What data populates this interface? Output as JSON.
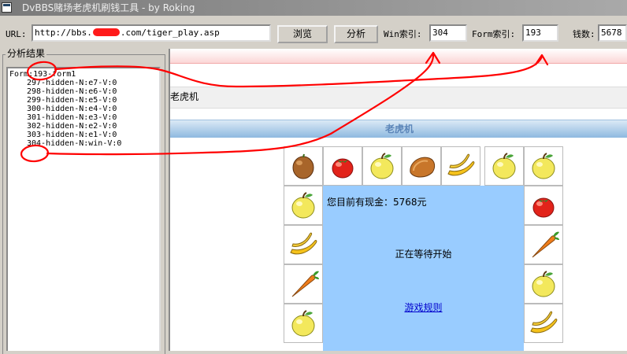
{
  "window": {
    "title": "DvBBS赌场老虎机刷钱工具 - by Roking"
  },
  "toolbar": {
    "url_label": "URL:",
    "url_prefix": "http://bbs.",
    "url_suffix": ".com/tiger_play.asp",
    "browse_label": "浏览",
    "analyze_label": "分析",
    "win_label": "Win索引:",
    "win_value": "304",
    "form_label": "Form索引:",
    "form_value": "193",
    "money_label": "钱数:",
    "money_value": "5678"
  },
  "results": {
    "title": "分析结果",
    "root": "Form:193-form1",
    "items": [
      "297-hidden-N:e7-V:0",
      "298-hidden-N:e6-V:0",
      "299-hidden-N:e5-V:0",
      "300-hidden-N:e4-V:0",
      "301-hidden-N:e3-V:0",
      "302-hidden-N:e2-V:0",
      "303-hidden-N:e1-V:0",
      "304-hidden-N:win-V:0"
    ]
  },
  "web": {
    "nav_text": "老虎机",
    "header_title": "老虎机",
    "cash_text": "您目前有现金：5768元",
    "status_text": "正在等待开始",
    "rules_link": "游戏规则",
    "top_row": [
      "potato",
      "tomato",
      "apple",
      "bread",
      "banana",
      "apple",
      "apple"
    ],
    "left_col": [
      "apple",
      "banana",
      "carrot",
      "apple"
    ],
    "right_col": [
      "tomato",
      "carrot",
      "apple",
      "banana"
    ]
  },
  "colors": {
    "annotation": "#ff0000",
    "center_panel": "#99ccff"
  }
}
